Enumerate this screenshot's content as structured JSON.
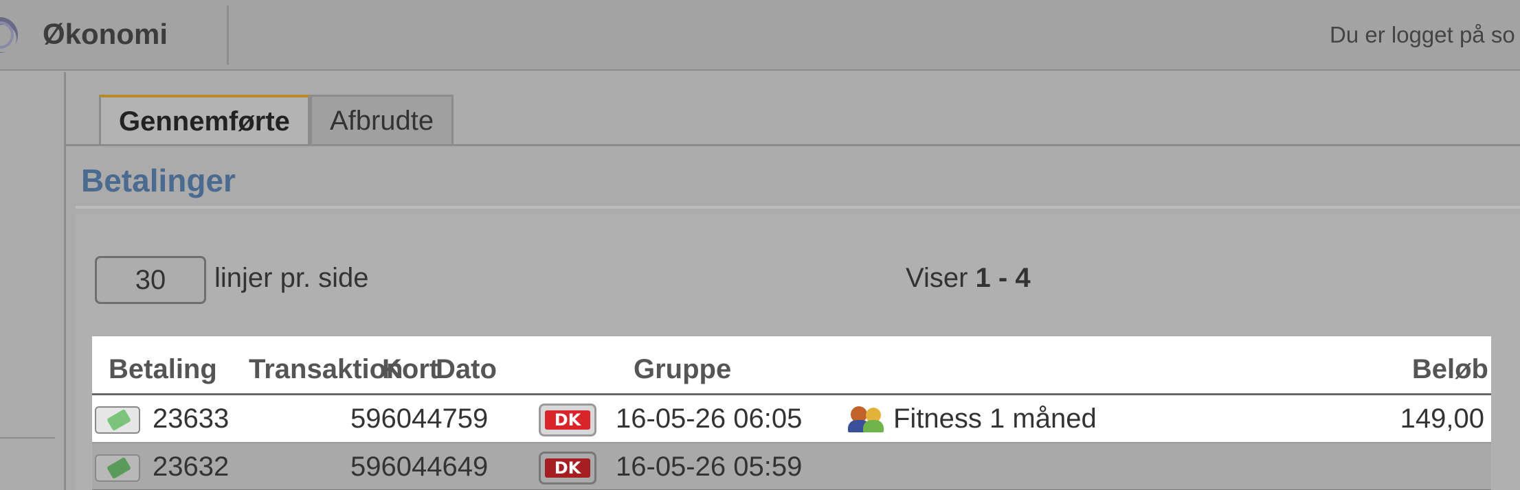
{
  "header": {
    "app_title": "Økonomi",
    "login_text": "Du er logget på so"
  },
  "tabs": [
    {
      "label": "Gennemførte",
      "active": true
    },
    {
      "label": "Afbrudte",
      "active": false
    }
  ],
  "section": {
    "title": "Betalinger"
  },
  "paging": {
    "lines_per_page": "30",
    "lines_label": "linjer pr. side",
    "viser_label": "Viser",
    "viser_range": "1 - 4"
  },
  "table": {
    "columns": [
      "Betaling",
      "Transaktion",
      "Kort",
      "Dato",
      "Gruppe",
      "Beløb"
    ],
    "rows": [
      {
        "betaling": "23633",
        "transaktion": "596044759",
        "kort": "DK",
        "dato": "16-05-26 06:05",
        "gruppe": "Fitness 1 måned",
        "beloeb": "149,00"
      },
      {
        "betaling": "23632",
        "transaktion": "596044649",
        "kort": "DK",
        "dato": "16-05-26 05:59",
        "gruppe": "",
        "beloeb": ""
      }
    ]
  },
  "colors": {
    "accent_tab": "#b58a2a",
    "section_title": "#4a6a90",
    "dankort_red": "#d9252a"
  },
  "icons": [
    "logo-icon",
    "payment-icon",
    "dankort-icon",
    "group-icon"
  ]
}
